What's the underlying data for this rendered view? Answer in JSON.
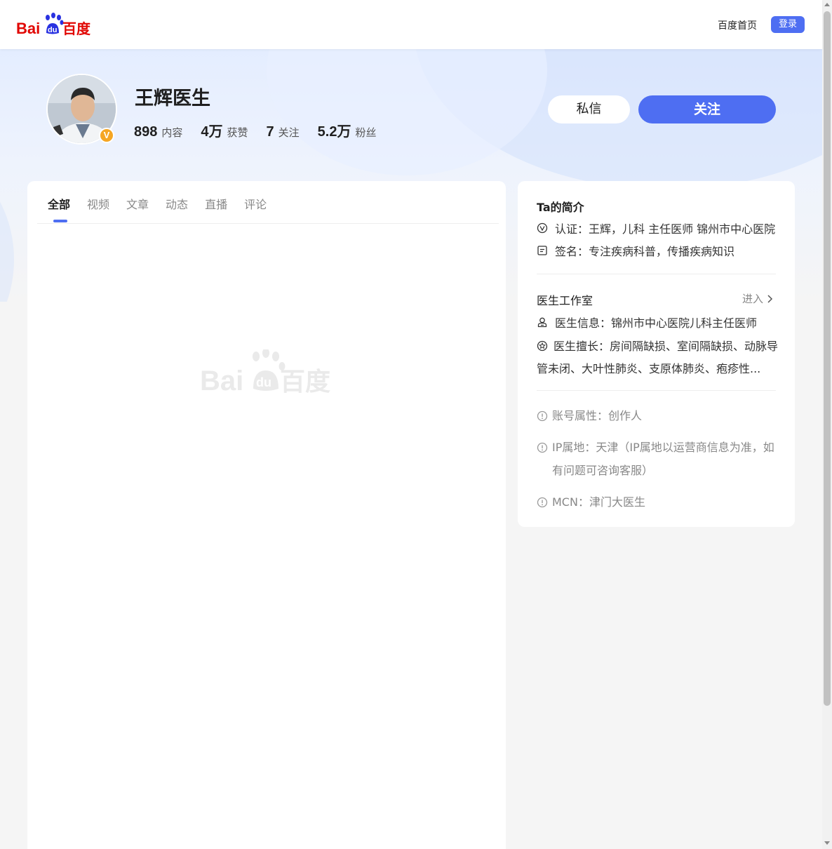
{
  "header": {
    "logo_text_left": "Bai",
    "logo_text_paw": "du",
    "logo_text_right": "百度",
    "home_link": "百度首页",
    "login_label": "登录"
  },
  "profile": {
    "name": "王辉医生",
    "verified_badge": "V",
    "stats": [
      {
        "num": "898",
        "label": "内容"
      },
      {
        "num": "4万",
        "label": "获赞"
      },
      {
        "num": "7",
        "label": "关注"
      },
      {
        "num": "5.2万",
        "label": "粉丝"
      }
    ],
    "message_label": "私信",
    "follow_label": "关注"
  },
  "tabs": [
    "全部",
    "视频",
    "文章",
    "动态",
    "直播",
    "评论"
  ],
  "intro": {
    "title": "Ta的简介",
    "certification": "认证：王辉，儿科 主任医师 锦州市中心医院",
    "signature": "签名：专注疾病科普，传播疾病知识",
    "studio_title": "医生工作室",
    "studio_enter": "进入",
    "doctor_info": "医生信息：锦州市中心医院儿科主任医师",
    "doctor_skills": "医生擅长：房间隔缺损、室间隔缺损、动脉导管未闭、大叶性肺炎、支原体肺炎、疱疹性...",
    "account_type": "账号属性：创作人",
    "ip_location": "IP属地：天津（IP属地以运营商信息为准，如有问题可咨询客服）",
    "mcn": "MCN：津门大医生"
  },
  "colors": {
    "brand_blue": "#4e6ef2",
    "baidu_blue": "#2932e1",
    "baidu_red": "#e10602",
    "badge_orange": "#f5a623"
  }
}
